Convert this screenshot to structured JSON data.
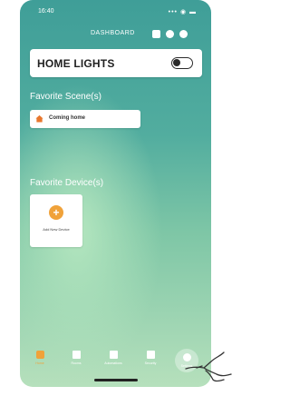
{
  "status_bar": {
    "time": "16:40",
    "signal": "••• ◉ ▬"
  },
  "header": {
    "title": "DASHBOARD",
    "icons": [
      "message-icon",
      "check-icon",
      "plus-icon"
    ]
  },
  "home_lights": {
    "label": "HOME LIGHTS",
    "toggle_on": false
  },
  "favorite_scenes": {
    "title": "Favorite Scene(s)",
    "items": [
      {
        "label": "Coming home",
        "icon": "home-icon",
        "icon_color": "#e8772e"
      }
    ]
  },
  "favorite_devices": {
    "title": "Favorite Device(s)",
    "add_label": "Add New Device",
    "add_icon": "plus-icon",
    "accent": "#f0a23a"
  },
  "tabs": [
    {
      "label": "Home",
      "icon": "home-icon",
      "active": true
    },
    {
      "label": "Rooms",
      "icon": "rooms-icon",
      "active": false
    },
    {
      "label": "Automations",
      "icon": "automation-icon",
      "active": false
    },
    {
      "label": "Security",
      "icon": "shield-icon",
      "active": false
    },
    {
      "label": "Settings",
      "icon": "gear-icon",
      "active": false
    }
  ],
  "colors": {
    "accent": "#f0a23a",
    "background_top": "#3f9e98",
    "background_bottom": "#b6e0bc"
  }
}
